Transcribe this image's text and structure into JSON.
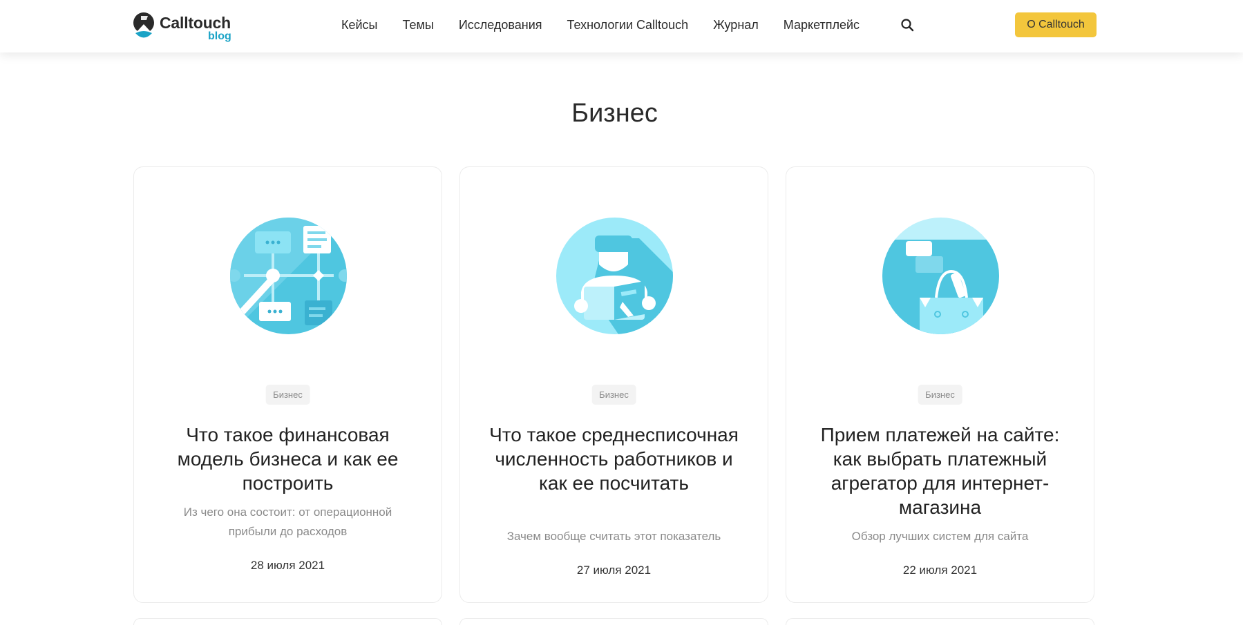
{
  "header": {
    "logo": {
      "name": "Calltouch",
      "sub": "blog"
    },
    "nav": [
      "Кейсы",
      "Темы",
      "Исследования",
      "Технологии Calltouch",
      "Журнал",
      "Маркетплейс"
    ],
    "search_icon": "search-icon",
    "about_button": "О Calltouch"
  },
  "page": {
    "title": "Бизнес"
  },
  "colors": {
    "accent": "#f3c63c",
    "brand": "#1aa3c6",
    "illustration": "#4fc6e0"
  },
  "cards": [
    {
      "tag": "Бизнес",
      "title": "Что такое финансовая модель бизнеса и как ее построить",
      "subtitle": "Из чего она состоит: от операционной прибыли до расходов",
      "date": "28 июля 2021",
      "icon": "flowchart-illustration"
    },
    {
      "tag": "Бизнес",
      "title": "Что такое среднесписочная численность работников и как ее посчитать",
      "subtitle": "Зачем вообще считать этот показатель",
      "date": "27 июля 2021",
      "icon": "reading-person-illustration"
    },
    {
      "tag": "Бизнес",
      "title": "Прием платежей на сайте: как выбрать платежный агрегатор для интернет-магазина",
      "subtitle": "Обзор лучших систем для сайта",
      "date": "22 июля 2021",
      "icon": "shopping-bag-illustration"
    }
  ]
}
